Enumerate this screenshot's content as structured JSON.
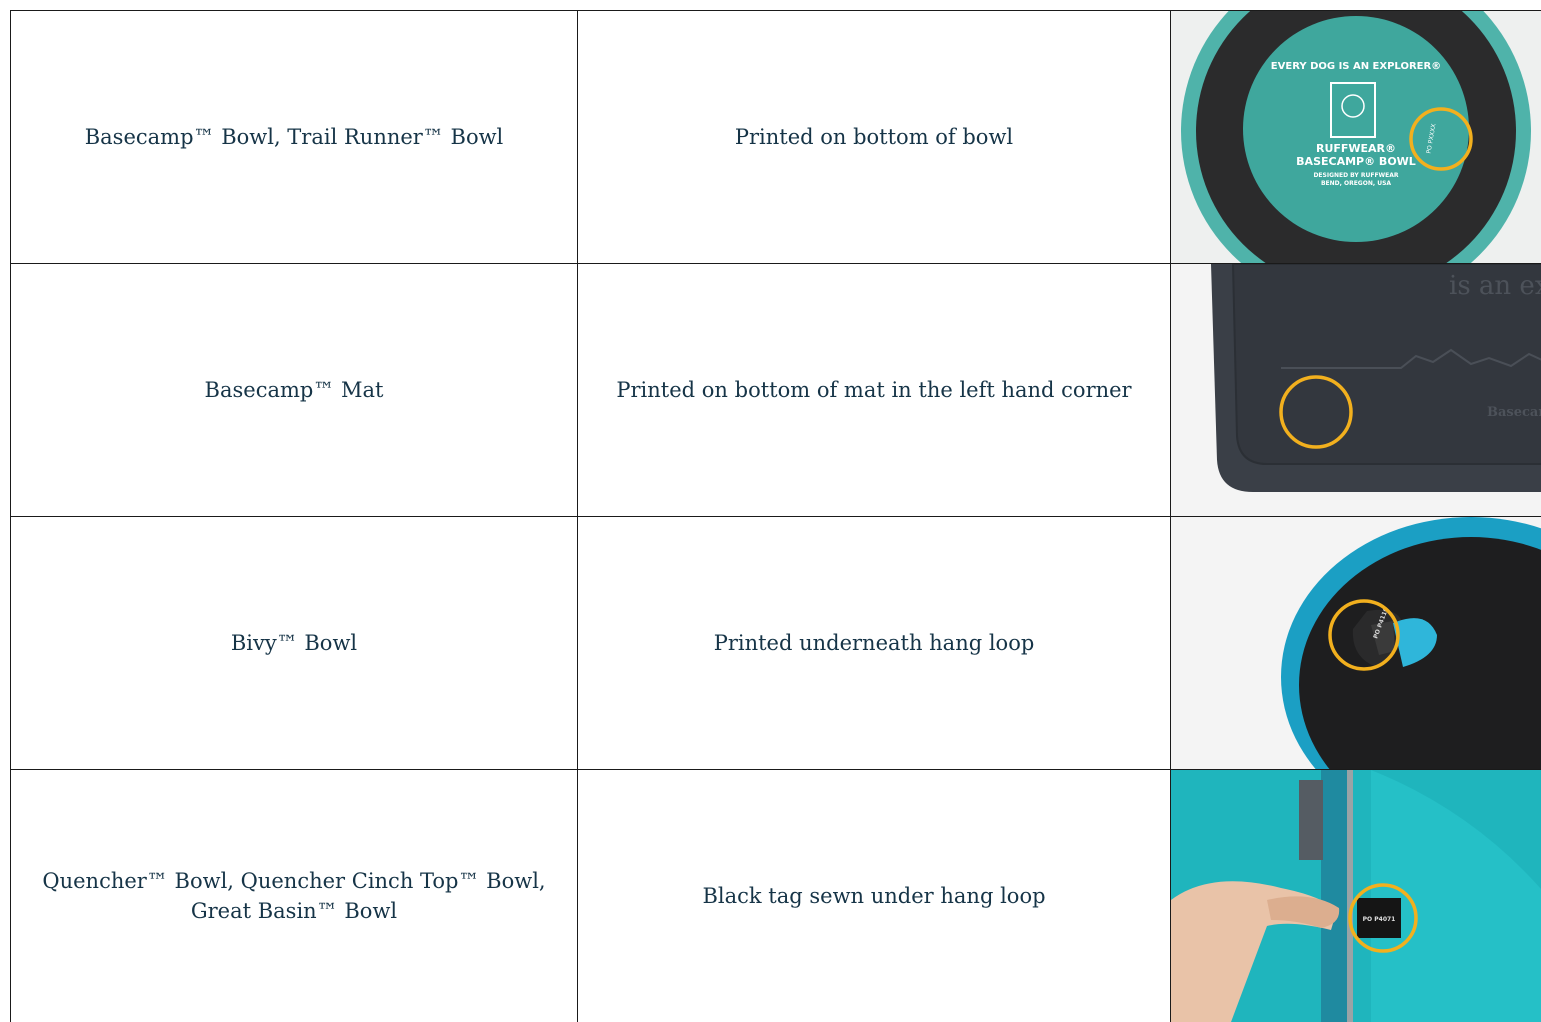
{
  "rows": [
    {
      "product": "Basecamp™ Bowl, Trail Runner™ Bowl",
      "location": "Printed on bottom of bowl",
      "image": {
        "icon": "bowl-bottom-photo-icon",
        "text_lines": [
          "EVERY DOG IS AN EXPLORER®",
          "RUFFWEAR®",
          "BASECAMP® BOWL",
          "DESIGNED BY RUFFWEAR",
          "BEND, OREGON, USA",
          "PO PXXXX"
        ],
        "colors": {
          "rim": "#4fb3aa",
          "base": "#2b2b2c",
          "center": "#3fa79d",
          "highlight": "#f2b01e"
        }
      }
    },
    {
      "product": "Basecamp™ Mat",
      "location": "Printed on bottom of mat in the left hand corner",
      "image": {
        "icon": "mat-bottom-photo-icon",
        "text_lines": [
          "is an ex",
          "Basecam"
        ],
        "colors": {
          "mat": "#3a3f47",
          "background": "#f4f4f4",
          "highlight": "#f2b01e"
        }
      }
    },
    {
      "product": "Bivy™ Bowl",
      "location": "Printed underneath hang loop",
      "image": {
        "icon": "bivy-loop-photo-icon",
        "text_lines": [
          "PO P4110"
        ],
        "colors": {
          "rim": "#1b9fc4",
          "base": "#1e1e1f",
          "loop": "#2fb6da",
          "background": "#f4f4f4",
          "highlight": "#f2b01e"
        }
      }
    },
    {
      "product": "Quencher™ Bowl, Quencher Cinch Top™ Bowl, Great Basin™ Bowl",
      "location": "Black tag sewn under hang loop",
      "image": {
        "icon": "quencher-tag-photo-icon",
        "text_lines": [
          "PO P4071"
        ],
        "colors": {
          "fabric": "#1fb5bd",
          "strap": "#1f8aa0",
          "tag": "#151515",
          "skin": "#e9c3a8",
          "highlight": "#f2b01e"
        }
      }
    }
  ]
}
